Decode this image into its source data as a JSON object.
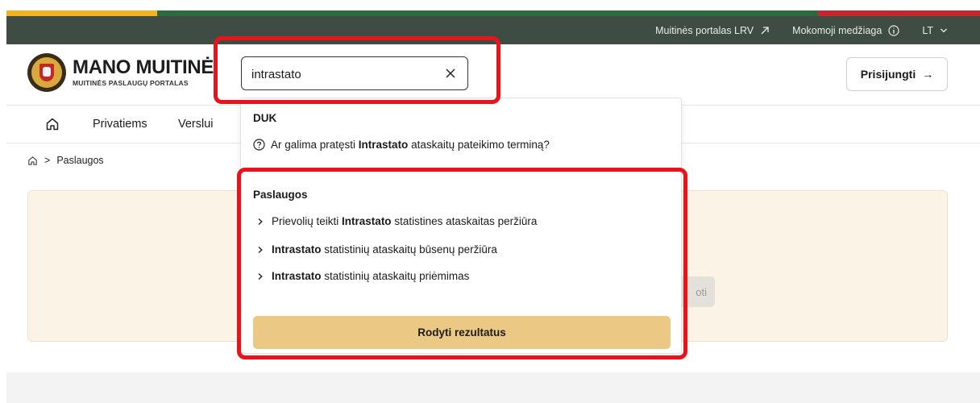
{
  "topbar": {
    "portal_link": "Muitinės portalas LRV",
    "materials_link": "Mokomoji medžiaga",
    "language": "LT",
    "icons": [
      "external-arrow-icon",
      "info-icon",
      "chevron-down-icon"
    ]
  },
  "header": {
    "logo_title": "MANO MUITINĖ",
    "logo_subtitle": "MUITINĖS PASLAUGŲ PORTALAS",
    "search_value": "intrastato",
    "login_label": "Prisijungti",
    "login_arrow": "→"
  },
  "nav": {
    "items": [
      "Privatiems",
      "Verslui"
    ]
  },
  "breadcrumb": {
    "separator": ">",
    "current": "Paslaugos"
  },
  "card": {
    "partial_button": "oti"
  },
  "dropdown": {
    "faq_heading": "DUK",
    "faq_items": [
      {
        "pre": "Ar galima pratęsti ",
        "bold": "Intrastato",
        "post": " ataskaitų pateikimo terminą?"
      }
    ],
    "services_heading": "Paslaugos",
    "services": [
      {
        "pre": "Prievolių teikti ",
        "bold": "Intrastato",
        "post": " statistines ataskaitas peržiūra"
      },
      {
        "pre": "",
        "bold": "Intrastato",
        "post": " statistinių ataskaitų būsenų peržiūra"
      },
      {
        "pre": "",
        "bold": "Intrastato",
        "post": " statistinių ataskaitų priėmimas"
      }
    ],
    "show_results": "Rodyti rezultatus"
  },
  "colors": {
    "flag_yellow": "#f0b323",
    "flag_green": "#2b6b3f",
    "flag_red": "#c6262e",
    "topbar_bg": "#3f4c43",
    "results_button": "#ebc985",
    "highlight_frame": "#e8141b",
    "card_bg": "#fbf4e6"
  }
}
